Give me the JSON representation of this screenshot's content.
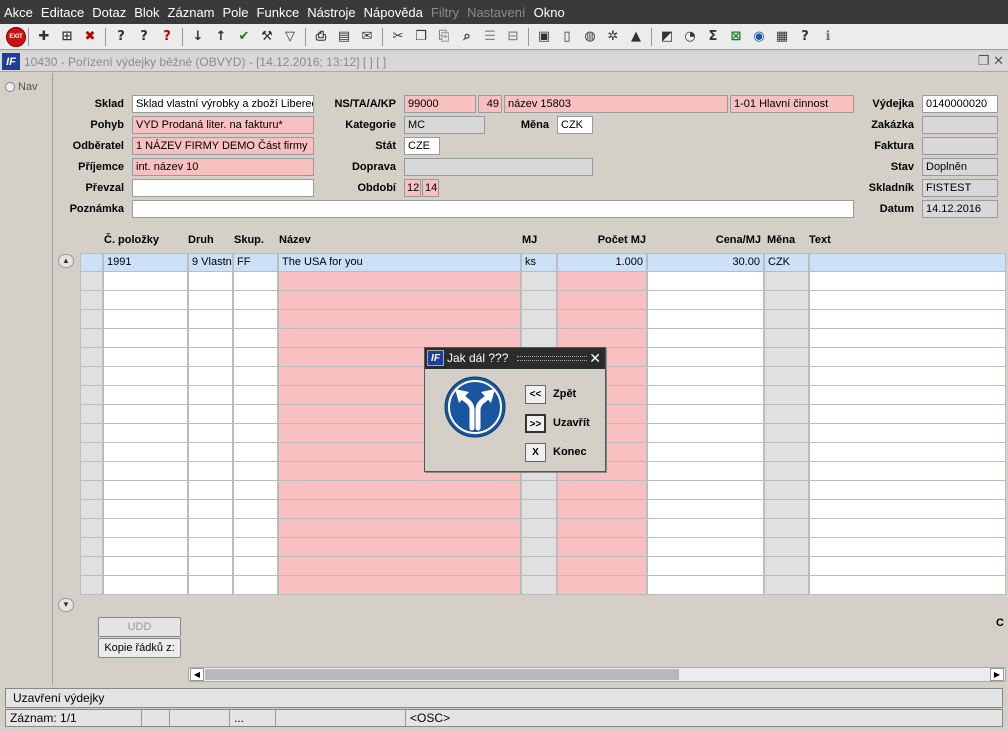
{
  "menubar": {
    "items": [
      {
        "label": "Akce",
        "disabled": false
      },
      {
        "label": "Editace",
        "disabled": false
      },
      {
        "label": "Dotaz",
        "disabled": false
      },
      {
        "label": "Blok",
        "disabled": false
      },
      {
        "label": "Záznam",
        "disabled": false
      },
      {
        "label": "Pole",
        "disabled": false
      },
      {
        "label": "Funkce",
        "disabled": false
      },
      {
        "label": "Nástroje",
        "disabled": false
      },
      {
        "label": "Nápověda",
        "disabled": false
      },
      {
        "label": "Filtry",
        "disabled": true
      },
      {
        "label": "Nastavení",
        "disabled": true
      },
      {
        "label": "Okno",
        "disabled": false
      }
    ]
  },
  "toolbar": {
    "exit_label": "EXIT"
  },
  "window": {
    "title": "10430 - Pořízení výdejky běžné (OBVYD) - [14.12.2016; 13:12]  [ ]  [ ]",
    "logo": "IF"
  },
  "nav": {
    "label": "Nav"
  },
  "form": {
    "sklad_label": "Sklad",
    "sklad_value": "Sklad vlastní výrobky a zboží Liberec",
    "pohyb_label": "Pohyb",
    "pohyb_value": "VYD Prodaná liter. na fakturu*",
    "odberatel_label": "Odběratel",
    "odberatel_value": "1 NÁZEV FIRMY DEMO Část firmy",
    "prijemce_label": "Příjemce",
    "prijemce_value": "int. název 10",
    "prevzal_label": "Převzal",
    "prevzal_value": "",
    "poznamka_label": "Poznámka",
    "poznamka_value": "",
    "nsta_label": "NS/TA/A/KP",
    "ns_value": "99000",
    "ta_value": "49",
    "a_value": "název 15803",
    "kp_value": "1-01 Hlavní činnost",
    "kategorie_label": "Kategorie",
    "kategorie_value": "MC",
    "mena_label": "Měna",
    "mena_value": "CZK",
    "stat_label": "Stát",
    "stat_value": "CZE",
    "doprava_label": "Doprava",
    "doprava_value": "",
    "obdobi_label": "Období",
    "obdobi_month": "12",
    "obdobi_year": "14",
    "vydejka_label": "Výdejka",
    "vydejka_value": "0140000020",
    "zakazka_label": "Zakázka",
    "zakazka_value": "",
    "faktura_label": "Faktura",
    "faktura_value": "",
    "stav_label": "Stav",
    "stav_value": "Doplněn",
    "skladnik_label": "Skladník",
    "skladnik_value": "FISTEST",
    "datum_label": "Datum",
    "datum_value": "14.12.2016"
  },
  "grid": {
    "headers": {
      "cislo": "Č. položky",
      "druh": "Druh",
      "skup": "Skup.",
      "nazev": "Název",
      "mj": "MJ",
      "pocet": "Počet MJ",
      "cena": "Cena/MJ",
      "mena": "Měna",
      "text": "Text"
    },
    "rows": [
      {
        "cislo": "1991",
        "druh": "9 Vlastn",
        "skup": "FF",
        "nazev": "The USA for you",
        "mj": "ks",
        "pocet": "1.000",
        "cena": "30.00",
        "mena": "CZK",
        "text": ""
      }
    ],
    "empty_rows": 17
  },
  "buttons": {
    "udd": "UDD",
    "kopie": "Kopie řádků z:"
  },
  "side_letter": "C",
  "dialog": {
    "title": "Jak dál ???",
    "back_btn": "<<",
    "back_label": "Zpět",
    "close_btn": ">>",
    "close_label": "Uzavřít",
    "end_btn": "X",
    "end_label": "Konec"
  },
  "status": {
    "message": "Uzavření výdejky",
    "record": "Záznam: 1/1",
    "seg3": "...",
    "mode": "<OSC>"
  },
  "colors": {
    "required": "#f8c0c0",
    "selected_row": "#cce0f8",
    "dialog_icon": "#1a56a0"
  }
}
